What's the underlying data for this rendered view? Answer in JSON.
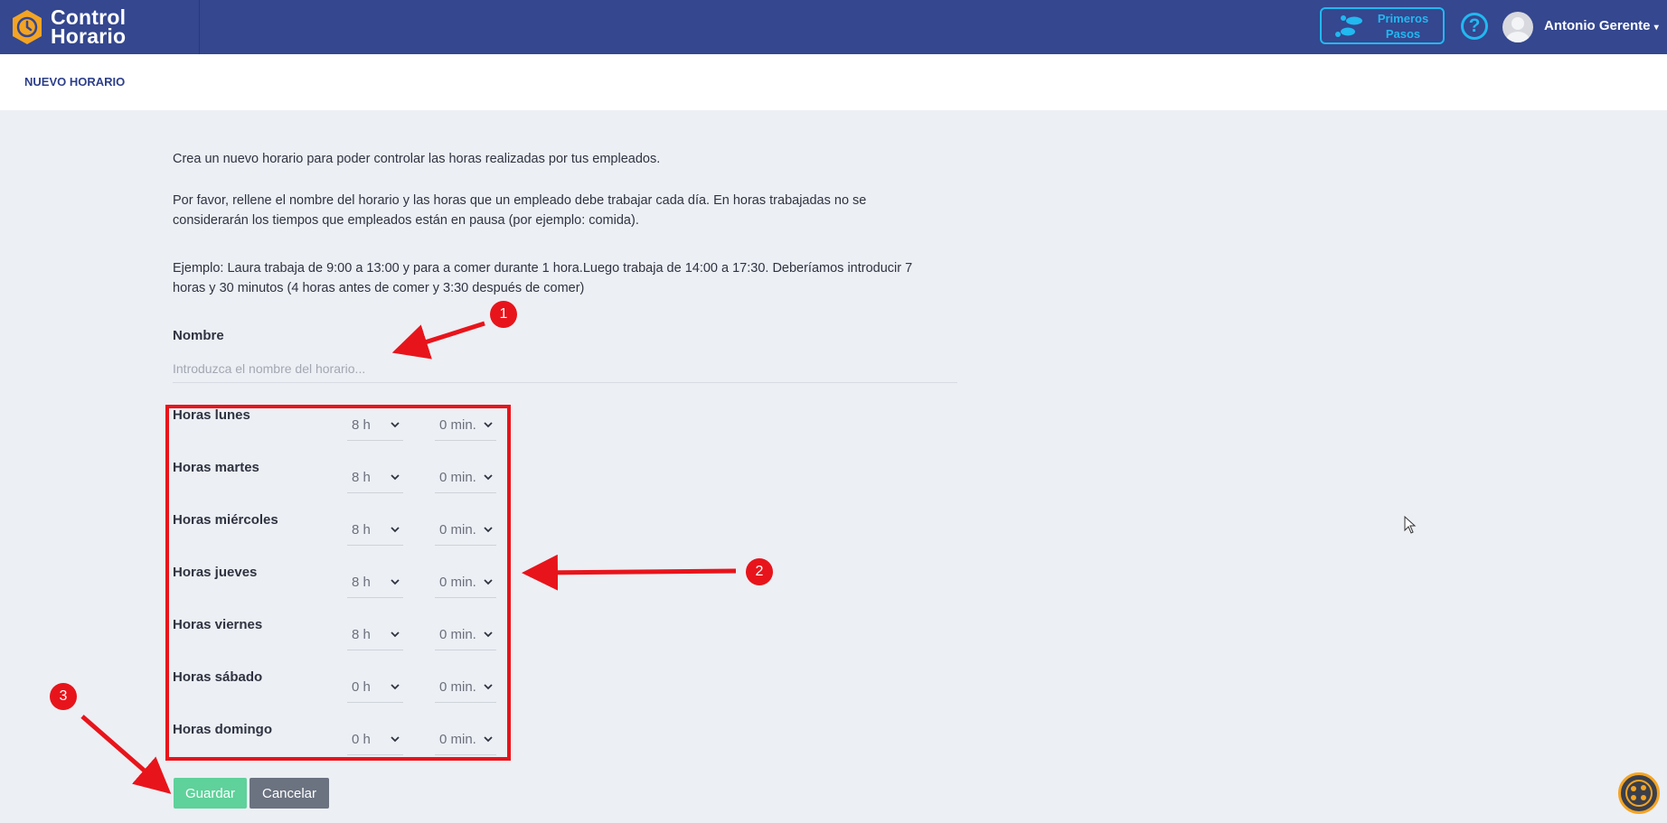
{
  "header": {
    "brand_line1": "Control",
    "brand_line2": "Horario",
    "first_steps_line1": "Primeros",
    "first_steps_line2": "Pasos",
    "help_label": "?",
    "user_name": "Antonio Gerente",
    "colors": {
      "bar": "#34478f",
      "accent": "#22b8f0",
      "logo": "#f4a423"
    }
  },
  "page": {
    "title": "NUEVO HORARIO",
    "intro": "Crea un nuevo horario para poder controlar las horas realizadas por tus empleados.",
    "instructions_1": "Por favor, rellene el nombre del horario y las horas que un empleado debe trabajar cada día. En horas trabajadas no se",
    "instructions_2": "considerarán los tiempos que empleados están en pausa (por ejemplo: comida).",
    "example_1": "Ejemplo: Laura trabaja de 9:00 a 13:00 y para a comer durante 1 hora.Luego trabaja de 14:00 a 17:30. Deberíamos introducir 7",
    "example_2": "horas y 30 minutos (4 horas antes de comer y 3:30 después de comer)"
  },
  "form": {
    "name_label": "Nombre",
    "name_value": "",
    "name_placeholder": "Introduzca el nombre del horario...",
    "days": [
      {
        "label": "Horas lunes",
        "hours": "8 h",
        "minutes": "0 min."
      },
      {
        "label": "Horas martes",
        "hours": "8 h",
        "minutes": "0 min."
      },
      {
        "label": "Horas miércoles",
        "hours": "8 h",
        "minutes": "0 min."
      },
      {
        "label": "Horas jueves",
        "hours": "8 h",
        "minutes": "0 min."
      },
      {
        "label": "Horas viernes",
        "hours": "8 h",
        "minutes": "0 min."
      },
      {
        "label": "Horas sábado",
        "hours": "0 h",
        "minutes": "0 min."
      },
      {
        "label": "Horas domingo",
        "hours": "0 h",
        "minutes": "0 min."
      }
    ],
    "save_label": "Guardar",
    "cancel_label": "Cancelar"
  },
  "annotations": {
    "badge1": "1",
    "badge2": "2",
    "badge3": "3",
    "color": "#e8141b"
  }
}
